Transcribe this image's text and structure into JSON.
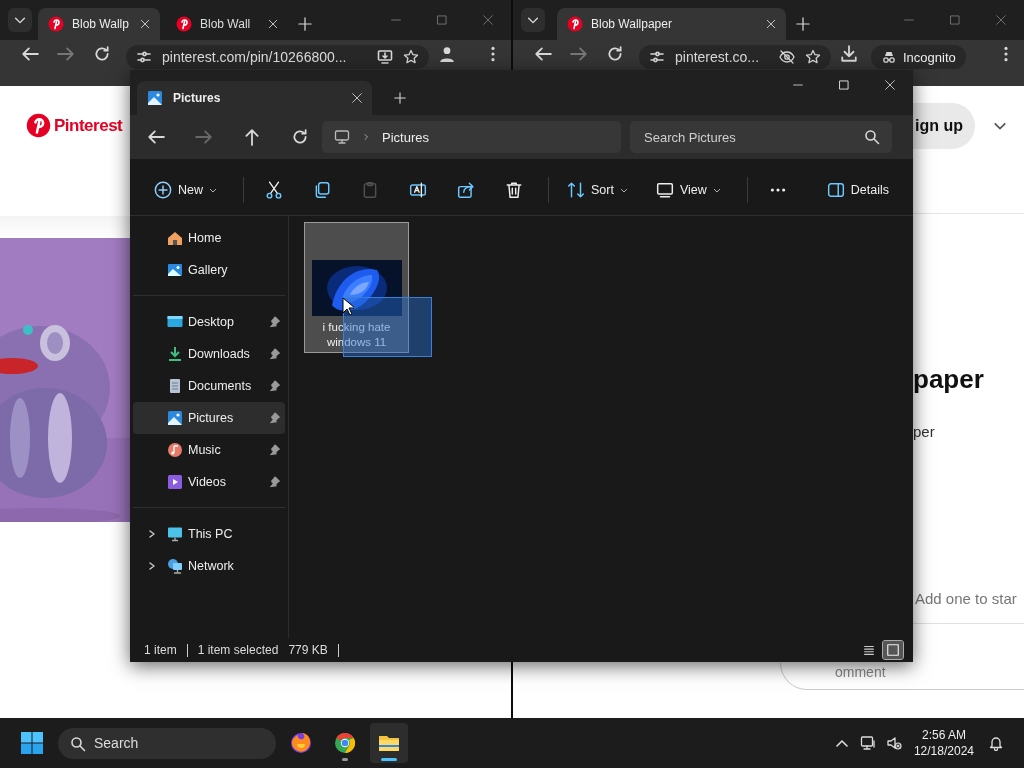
{
  "browsers": [
    {
      "tabs": [
        {
          "title": "Blob Wallp",
          "selected": true
        },
        {
          "title": "Blob Wall",
          "selected": false
        }
      ],
      "address": "pinterest.com/pin/10266800...",
      "profile": {
        "kind": "avatar"
      },
      "page": {
        "kind": "logo",
        "logo": "Pinterest"
      }
    },
    {
      "tabs": [
        {
          "title": "Blob Wallpaper",
          "selected": true
        }
      ],
      "address": "pinterest.co...",
      "profile": {
        "kind": "incognito",
        "label": "Incognito"
      },
      "page": {
        "kind": "pin",
        "button": "ign up",
        "heading": "paper",
        "subtitle": "per",
        "comment_hint": "Add one to star",
        "comment_field": "omment"
      }
    }
  ],
  "explorer": {
    "tabs": [
      {
        "title": "Pictures",
        "selected": true
      }
    ],
    "nav": [
      {
        "kind": "back",
        "disabled": false
      },
      {
        "kind": "forward",
        "disabled": true
      },
      {
        "kind": "up",
        "disabled": false
      },
      {
        "kind": "refresh",
        "disabled": false
      }
    ],
    "breadcrumb": [
      "Pictures"
    ],
    "search": {
      "placeholder": "Search Pictures"
    },
    "commands": [
      {
        "kind": "new",
        "label": "New",
        "disabled": false
      },
      {
        "kind": "separator"
      },
      {
        "kind": "cut",
        "disabled": false
      },
      {
        "kind": "copy",
        "disabled": false
      },
      {
        "kind": "paste",
        "disabled": true
      },
      {
        "kind": "rename",
        "disabled": false
      },
      {
        "kind": "share",
        "disabled": false
      },
      {
        "kind": "delete",
        "disabled": false
      },
      {
        "kind": "separator"
      },
      {
        "kind": "sort",
        "label": "Sort",
        "disabled": false
      },
      {
        "kind": "view",
        "label": "View",
        "disabled": false
      },
      {
        "kind": "separator"
      },
      {
        "kind": "more",
        "disabled": false
      },
      {
        "kind": "details",
        "label": "Details",
        "disabled": false
      }
    ],
    "sidebar": [
      {
        "items": [
          {
            "kind": "home",
            "label": "Home",
            "pinned": false,
            "selected": false,
            "expandable": false
          },
          {
            "kind": "gallery",
            "label": "Gallery",
            "pinned": false,
            "selected": false,
            "expandable": false
          }
        ]
      },
      {
        "items": [
          {
            "kind": "desktop",
            "label": "Desktop",
            "pinned": true,
            "selected": false,
            "expandable": false
          },
          {
            "kind": "downloads",
            "label": "Downloads",
            "pinned": true,
            "selected": false,
            "expandable": false
          },
          {
            "kind": "documents",
            "label": "Documents",
            "pinned": true,
            "selected": false,
            "expandable": false
          },
          {
            "kind": "pictures",
            "label": "Pictures",
            "pinned": true,
            "selected": true,
            "expandable": false
          },
          {
            "kind": "music",
            "label": "Music",
            "pinned": true,
            "selected": false,
            "expandable": false
          },
          {
            "kind": "videos",
            "label": "Videos",
            "pinned": true,
            "selected": false,
            "expandable": false
          }
        ]
      },
      {
        "items": [
          {
            "kind": "pc",
            "label": "This PC",
            "pinned": false,
            "selected": false,
            "expandable": true
          },
          {
            "kind": "network",
            "label": "Network",
            "pinned": false,
            "selected": false,
            "expandable": true
          }
        ]
      }
    ],
    "files": [
      {
        "name": "i fucking hate windows 11",
        "selected": true
      }
    ],
    "dragging": true,
    "status": {
      "count": "1 item",
      "selection": "1 item selected",
      "size": "779 KB"
    },
    "views": [
      {
        "kind": "details",
        "selected": false
      },
      {
        "kind": "tiles",
        "selected": true
      }
    ]
  },
  "taskbar": {
    "search_placeholder": "Search",
    "apps": [
      {
        "kind": "firefox",
        "running": false,
        "active": false
      },
      {
        "kind": "chrome",
        "running": true,
        "active": false
      },
      {
        "kind": "explorer",
        "running": true,
        "active": true
      }
    ],
    "time": "2:56 AM",
    "date": "12/18/2024"
  }
}
